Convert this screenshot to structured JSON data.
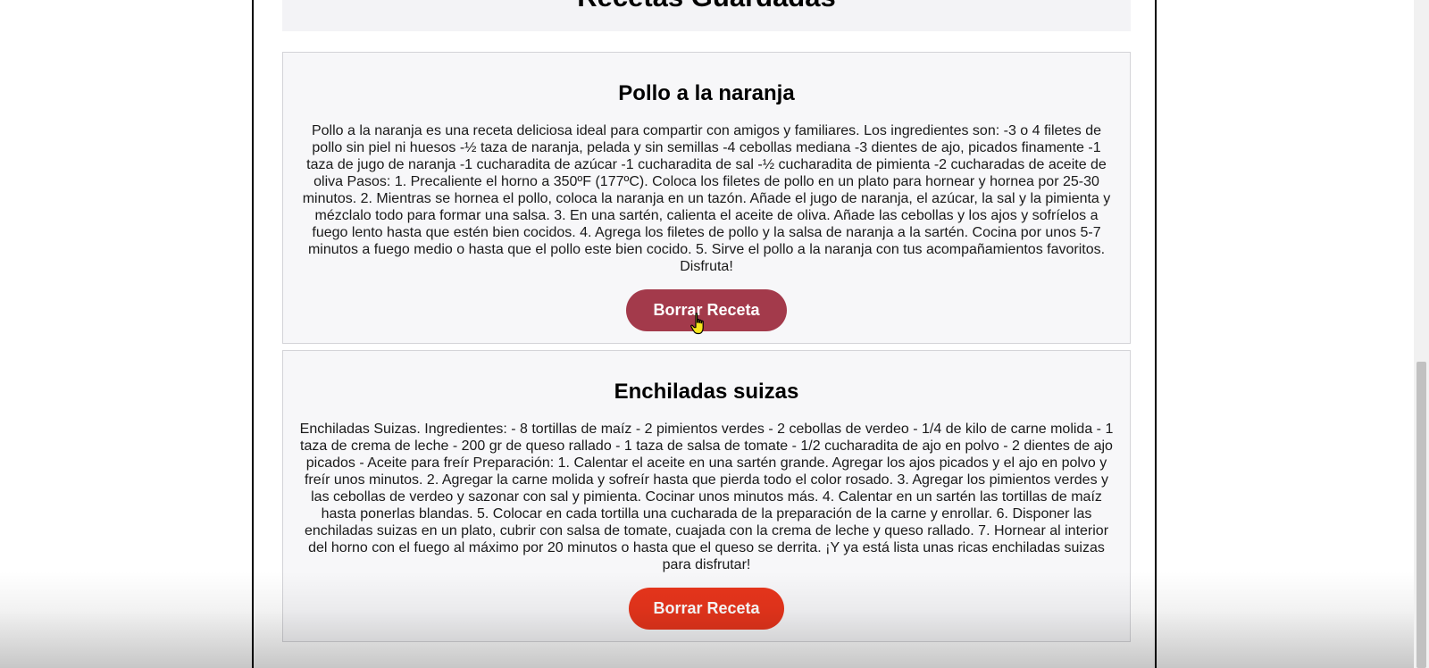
{
  "header": {
    "title": "Recetas Guardadas"
  },
  "recipes": [
    {
      "title": "Pollo a la naranja",
      "description": "Pollo a la naranja es una receta deliciosa ideal para compartir con amigos y familiares. Los ingredientes son: -3 o 4 filetes de pollo sin piel ni huesos -½ taza de naranja, pelada y sin semillas -4 cebollas mediana -3 dientes de ajo, picados finamente -1 taza de jugo de naranja -1 cucharadita de azúcar -1 cucharadita de sal -½ cucharadita de pimienta -2 cucharadas de aceite de oliva Pasos: 1. Precaliente el horno a 350ºF (177ºC). Coloca los filetes de pollo en un plato para hornear y hornea por 25-30 minutos. 2. Mientras se hornea el pollo, coloca la naranja en un tazón. Añade el jugo de naranja, el azúcar, la sal y la pimienta y mézclalo todo para formar una salsa. 3. En una sartén, calienta el aceite de oliva. Añade las cebollas y los ajos y sofríelos a fuego lento hasta que estén bien cocidos. 4. Agrega los filetes de pollo y la salsa de naranja a la sartén. Cocina por unos 5-7 minutos a fuego medio o hasta que el pollo este bien cocido. 5. Sirve el pollo a la naranja con tus acompañamientos favoritos. Disfruta!",
      "delete_label": "Borrar Receta"
    },
    {
      "title": "Enchiladas suizas",
      "description": "Enchiladas Suizas. Ingredientes: - 8 tortillas de maíz - 2 pimientos verdes - 2 cebollas de verdeo - 1/4 de kilo de carne molida - 1 taza de crema de leche - 200 gr de queso rallado - 1 taza de salsa de tomate - 1/2 cucharadita de ajo en polvo - 2 dientes de ajo picados - Aceite para freír Preparación: 1. Calentar el aceite en una sartén grande. Agregar los ajos picados y el ajo en polvo y freír unos minutos. 2. Agregar la carne molida y sofreír hasta que pierda todo el color rosado. 3. Agregar los pimientos verdes y las cebollas de verdeo y sazonar con sal y pimienta. Cocinar unos minutos más. 4. Calentar en un sartén las tortillas de maíz hasta ponerlas blandas. 5. Colocar en cada tortilla una cucharada de la preparación de la carne y enrollar. 6. Disponer las enchiladas suizas en un plato, cubrir con salsa de tomate, cuajada con la crema de leche y queso rallado. 7. Hornear al interior del horno con el fuego al máximo por 20 minutos o hasta que el queso se derrita. ¡Y ya está lista unas ricas enchiladas suizas para disfrutar!",
      "delete_label": "Borrar Receta"
    }
  ],
  "colors": {
    "delete_button": "#e8351c",
    "delete_button_hover": "#a33a4b",
    "card_background": "#f7f7f9"
  },
  "icons": {
    "cursor": "hand-pointer-icon"
  }
}
